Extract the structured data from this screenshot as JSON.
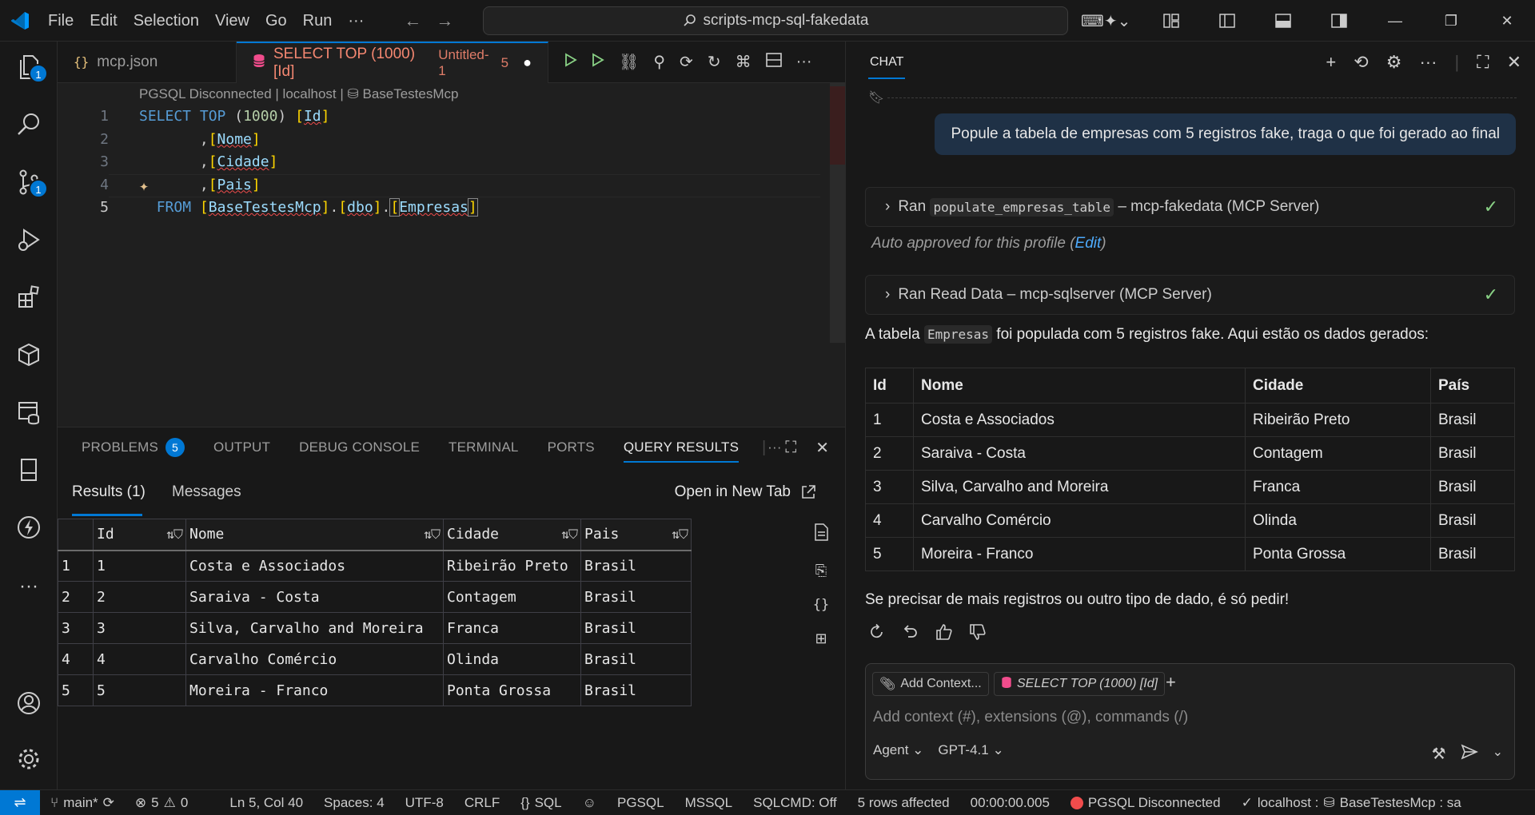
{
  "titlebar": {
    "menu": [
      "File",
      "Edit",
      "Selection",
      "View",
      "Go",
      "Run",
      "···"
    ],
    "search": "scripts-mcp-sql-fakedata"
  },
  "activity": {
    "explorer_badge": "1",
    "scm_badge": "1"
  },
  "tabs": {
    "tab1": "mcp.json",
    "tab2": "SELECT TOP (1000) [Id]",
    "tab2_suffix": "Untitled-1",
    "tab2_count": "5"
  },
  "editor": {
    "breadcrumb": "PGSQL Disconnected | localhost | ",
    "breadcrumb_db": "BaseTestesMcp",
    "line_numbers": [
      "1",
      "2",
      "3",
      "4",
      "5"
    ]
  },
  "panel": {
    "tabs": [
      "PROBLEMS",
      "OUTPUT",
      "DEBUG CONSOLE",
      "TERMINAL",
      "PORTS",
      "QUERY RESULTS"
    ],
    "problems_count": "5",
    "results_tab": "Results (1)",
    "messages_tab": "Messages",
    "open_new_tab": "Open in New Tab",
    "grid": {
      "columns": [
        "Id",
        "Nome",
        "Cidade",
        "Pais"
      ],
      "rows": [
        [
          "1",
          "1",
          "Costa e Associados",
          "Ribeirão Preto",
          "Brasil"
        ],
        [
          "2",
          "2",
          "Saraiva - Costa",
          "Contagem",
          "Brasil"
        ],
        [
          "3",
          "3",
          "Silva, Carvalho and Moreira",
          "Franca",
          "Brasil"
        ],
        [
          "4",
          "4",
          "Carvalho Comércio",
          "Olinda",
          "Brasil"
        ],
        [
          "5",
          "5",
          "Moreira - Franco",
          "Ponta Grossa",
          "Brasil"
        ]
      ]
    }
  },
  "chat": {
    "title": "CHAT",
    "user_message": "Popule a tabela de empresas com 5 registros fake, traga o que foi gerado ao final",
    "tool1_prefix": "Ran",
    "tool1_code": "populate_empresas_table",
    "tool1_suffix": "– mcp-fakedata (MCP Server)",
    "auto_approved": "Auto approved for this profile (",
    "edit_link": "Edit",
    "auto_close": ")",
    "tool2": "Ran Read Data – mcp-sqlserver (MCP Server)",
    "summary_prefix": "A tabela",
    "summary_code": "Empresas",
    "summary_suffix": "foi populada com 5 registros fake. Aqui estão os dados gerados:",
    "table": {
      "columns": [
        "Id",
        "Nome",
        "Cidade",
        "País"
      ],
      "rows": [
        [
          "1",
          "Costa e Associados",
          "Ribeirão Preto",
          "Brasil"
        ],
        [
          "2",
          "Saraiva - Costa",
          "Contagem",
          "Brasil"
        ],
        [
          "3",
          "Silva, Carvalho and Moreira",
          "Franca",
          "Brasil"
        ],
        [
          "4",
          "Carvalho Comércio",
          "Olinda",
          "Brasil"
        ],
        [
          "5",
          "Moreira - Franco",
          "Ponta Grossa",
          "Brasil"
        ]
      ]
    },
    "closing": "Se precisar de mais registros ou outro tipo de dado, é só pedir!",
    "add_context": "Add Context...",
    "context_chip": "SELECT TOP (1000) [Id]",
    "input_placeholder": "Add context (#), extensions (@), commands (/)",
    "mode": "Agent",
    "model": "GPT-4.1"
  },
  "statusbar": {
    "branch": "main*",
    "errors": "5",
    "warnings": "0",
    "position": "Ln 5, Col 40",
    "spaces": "Spaces: 4",
    "encoding": "UTF-8",
    "eol": "CRLF",
    "language": "SQL",
    "pgsql": "PGSQL",
    "mssql": "MSSQL",
    "sqlcmd": "SQLCMD: Off",
    "rows": "5 rows affected",
    "time": "00:00:00.005",
    "pg_status": "PGSQL Disconnected",
    "connection": "localhost : ",
    "connection_db": "BaseTestesMcp : sa"
  }
}
